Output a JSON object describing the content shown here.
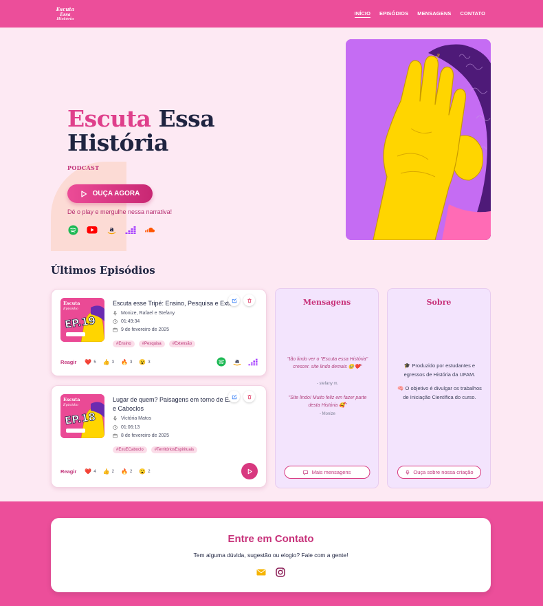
{
  "nav": {
    "logo_text": "Escuta Essa História",
    "links": [
      "INÍCIO",
      "EPISÓDIOS",
      "MENSAGENS",
      "CONTATO"
    ]
  },
  "hero": {
    "title_highlight": "Escuta",
    "title_rest_line1": "Essa",
    "title_line2": "História",
    "subtitle": "PODCAST",
    "cta_label": "OUÇA AGORA",
    "note": "Dé o play e mergulhe nessa narrativa!",
    "platforms": [
      "spotify-icon",
      "youtube-icon",
      "amazon-music-icon",
      "deezer-icon",
      "soundcloud-icon"
    ]
  },
  "episodes_section": {
    "title": "Últimos Episódios",
    "episodes": [
      {
        "cover_label": "EP.19",
        "cover_brand": "Escuta Essa História",
        "title": "Escuta esse Tripé: Ensino, Pesquisa e Extensão",
        "authors": "Monize, Rafael e Stefany",
        "duration": "01:49:34",
        "date": "9 de fevereiro de 2025",
        "tags": [
          "#Ensino",
          "#Pesquisa",
          "#Extensão"
        ],
        "reactions": {
          "heart": "5",
          "thumbs": "3",
          "fire": "3",
          "wow": "3"
        }
      },
      {
        "cover_label": "EP.18",
        "cover_brand": "Escuta Essa História",
        "title": "Lugar de quem? Paisagens em torno de Exu e Caboclos",
        "authors": "Victória Matos",
        "duration": "01:06:13",
        "date": "8 de fevereiro de 2025",
        "tags": [
          "#ExuECaboclo",
          "#TerritóriosEspirituais"
        ],
        "reactions": {
          "heart": "4",
          "thumbs": "2",
          "fire": "2",
          "wow": "2"
        }
      }
    ],
    "react_label": "Reagir"
  },
  "messages_panel": {
    "title": "Mensagens",
    "quote1": "\"tão lindo ver o \"Escuta essa História\" crescer. site lindo demais 🥹❤️\"",
    "author1": "- stefany m.",
    "quote2": "\"Site lindo! Muito feliz em fazer parte desta História 🥰\"",
    "author2": "- Monize",
    "button": "Mais mensagens"
  },
  "about_panel": {
    "title": "Sobre",
    "text1": "🎓 Produzido por estudantes e egressos de História da UFAM.",
    "text2": "🧠 O objetivo é divulgar os trabalhos de Iniciação Científica do curso.",
    "button": "Ouça sobre nossa criação"
  },
  "contact": {
    "title": "Entre em Contato",
    "text": "Tem alguma dúvida, sugestão ou elogio? Fale com a gente!"
  },
  "colors": {
    "brand_pink": "#ec4e9a",
    "accent": "#c7327a",
    "hero_bg": "#fde9f3",
    "panel_bg": "#f3e4fd"
  }
}
